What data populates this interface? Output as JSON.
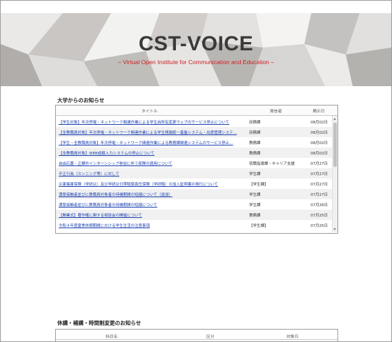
{
  "hero": {
    "title": "CST-VOICE",
    "subtitle": "– Virtual Open Institute for Communication and Education –"
  },
  "news": {
    "heading": "大学からのお知らせ",
    "columns": {
      "title": "タイトル",
      "dept": "発信者",
      "date": "掲示日"
    },
    "items": [
      {
        "title": "【学生対象】年次停電・ネットワーク関連作業による学生自所有変更ウェブのサービス停止について",
        "dept": "庶務課",
        "date": "08月02日"
      },
      {
        "title": "【全教職員対象】年次停電・ネットワーク関連作業による学生情報統一基盤システム・出席管理システ…",
        "dept": "庶務課",
        "date": "08月02日"
      },
      {
        "title": "【学生・全教職員対象】年次停電・ネットワーク関連作業による教務課関連システムのサービス停止…",
        "dept": "教務課",
        "date": "08月02日"
      },
      {
        "title": "【全教職員対象】WEB成績入力システムの停止について",
        "dept": "教務課",
        "date": "08月02日"
      },
      {
        "title": "自由応募・正課外インターンシップ参加に伴う保険の適用について",
        "dept": "就職指導課・キャリア支援セン…",
        "date": "07月27日"
      },
      {
        "title": "不正行為（カンニング等）に対して",
        "dept": "学生課",
        "date": "07月27日"
      },
      {
        "title": "災害傷害保険（学研災）及び学研災付帯賠償責任保険（学研賠）の加入証明書の発行について",
        "dept": "【学生課】",
        "date": "07月27日"
      },
      {
        "title": "濃厚接触者並びに教職員対象者の待機期間の短縮について（追加）",
        "dept": "学生課",
        "date": "07月27日"
      },
      {
        "title": "濃厚接触者並びに教職員対象者の待機期間の短縮について",
        "dept": "学生課",
        "date": "07月26日"
      },
      {
        "title": "【開業式】著作権に関する相談会の開催について",
        "dept": "教務課",
        "date": "07月25日"
      },
      {
        "title": "令和４年度夏季休暇期間における学生生活の注意事項",
        "dept": "【学生課】",
        "date": "07月25日"
      }
    ]
  },
  "classes": {
    "heading": "休講・補講・時間割変更のお知らせ",
    "columns": {
      "course": "科目名",
      "type": "区分",
      "date": "対象日"
    }
  }
}
